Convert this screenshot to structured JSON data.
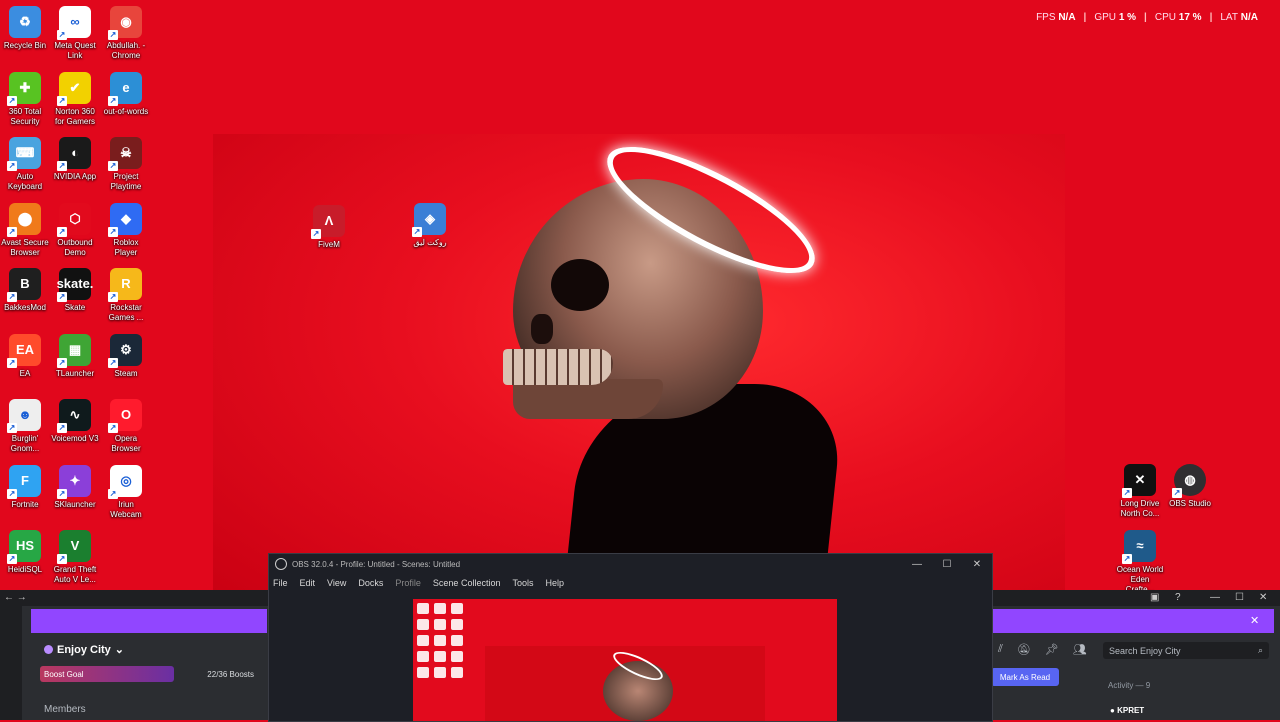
{
  "overlay_stats": {
    "fps_label": "FPS",
    "fps_value": "N/A",
    "gpu_label": "GPU",
    "gpu_value": "1 %",
    "cpu_label": "CPU",
    "cpu_value": "17 %",
    "lat_label": "LAT",
    "lat_value": "N/A"
  },
  "desktop_icons": [
    {
      "label": "Recycle Bin",
      "icon": "recycle-bin-icon",
      "color": "#3b8de0",
      "glyph": "♻"
    },
    {
      "label": "Meta Quest Link",
      "icon": "meta-quest-icon",
      "color": "#ffffff",
      "glyph": "∞"
    },
    {
      "label": "Abdullah. - Chrome",
      "icon": "chrome-icon",
      "color": "#e8453c",
      "glyph": "◉"
    },
    {
      "label": "360 Total Security",
      "icon": "360-security-icon",
      "color": "#58c322",
      "glyph": "✚"
    },
    {
      "label": "Norton 360 for Gamers",
      "icon": "norton-icon",
      "color": "#f2d100",
      "glyph": "✔"
    },
    {
      "label": "out-of-words",
      "icon": "edge-icon",
      "color": "#2c8fd6",
      "glyph": "e"
    },
    {
      "label": "Auto Keyboard",
      "icon": "auto-keyboard-icon",
      "color": "#4aa3df",
      "glyph": "⌨"
    },
    {
      "label": "NVIDIA App",
      "icon": "nvidia-icon",
      "color": "#1a1a1a",
      "glyph": "◐"
    },
    {
      "label": "Project Playtime",
      "icon": "project-playtime-icon",
      "color": "#7a1d1d",
      "glyph": "☠"
    },
    {
      "label": "Avast Secure Browser",
      "icon": "avast-icon",
      "color": "#f07a1a",
      "glyph": "⬤"
    },
    {
      "label": "Outbound Demo",
      "icon": "outbound-icon",
      "color": "#e20a1d",
      "glyph": "⬡"
    },
    {
      "label": "Roblox Player",
      "icon": "roblox-icon",
      "color": "#2f6bf3",
      "glyph": "◆"
    },
    {
      "label": "BakkesMod",
      "icon": "bakkesmod-icon",
      "color": "#1f1f1f",
      "glyph": "B"
    },
    {
      "label": "Skate",
      "icon": "skate-icon",
      "color": "#111111",
      "glyph": "skate."
    },
    {
      "label": "Rockstar Games ...",
      "icon": "rockstar-icon",
      "color": "#f6b81a",
      "glyph": "R"
    },
    {
      "label": "EA",
      "icon": "ea-icon",
      "color": "#ff4b2b",
      "glyph": "EA"
    },
    {
      "label": "TLauncher",
      "icon": "tlauncher-icon",
      "color": "#3fa535",
      "glyph": "▦"
    },
    {
      "label": "Steam",
      "icon": "steam-icon",
      "color": "#1b2838",
      "glyph": "⚙"
    },
    {
      "label": "Burglin' Gnom...",
      "icon": "burglin-gnomes-icon",
      "color": "#eeeeee",
      "glyph": "☻"
    },
    {
      "label": "Voicemod V3",
      "icon": "voicemod-icon",
      "color": "#0f1a1c",
      "glyph": "∿"
    },
    {
      "label": "Opera Browser",
      "icon": "opera-icon",
      "color": "#ff1b2d",
      "glyph": "O"
    },
    {
      "label": "Fortnite",
      "icon": "fortnite-icon",
      "color": "#2fa3f2",
      "glyph": "F"
    },
    {
      "label": "SKlauncher",
      "icon": "sklauncher-icon",
      "color": "#8b3fd9",
      "glyph": "✦"
    },
    {
      "label": "Iriun Webcam",
      "icon": "iriun-webcam-icon",
      "color": "#ffffff",
      "glyph": "◎"
    },
    {
      "label": "HeidiSQL",
      "icon": "heidisql-icon",
      "color": "#27a745",
      "glyph": "HS"
    },
    {
      "label": "Grand Theft Auto V Le...",
      "icon": "gta-v-icon",
      "color": "#1b7f2f",
      "glyph": "V"
    }
  ],
  "wallpaper_icons": [
    {
      "label": "FiveM",
      "icon": "fivem-icon"
    },
    {
      "label": "روكت ليق",
      "icon": "rocket-league-icon"
    }
  ],
  "right_icons": [
    {
      "label": "Long Drive North Co...",
      "icon": "long-drive-icon"
    },
    {
      "label": "OBS Studio",
      "icon": "obs-studio-icon"
    },
    {
      "label": "Ocean World Eden Crafte...",
      "icon": "ocean-world-icon"
    }
  ],
  "obs": {
    "title": "OBS 32.0.4 - Profile: Untitled - Scenes: Untitled",
    "menu": [
      "File",
      "Edit",
      "View",
      "Docks",
      "Profile",
      "Scene Collection",
      "Tools",
      "Help"
    ]
  },
  "discord": {
    "server_name": "Enjoy City",
    "boost_label": "Boost Goal",
    "boost_count": "22/36 Boosts",
    "boost_fraction": 0.61,
    "members_label": "Members",
    "search_placeholder": "Search Enjoy City",
    "mark_read": "Mark As Read",
    "activity": "Activity — 9",
    "member_name": "KPRET",
    "accent": "#9146ff"
  }
}
